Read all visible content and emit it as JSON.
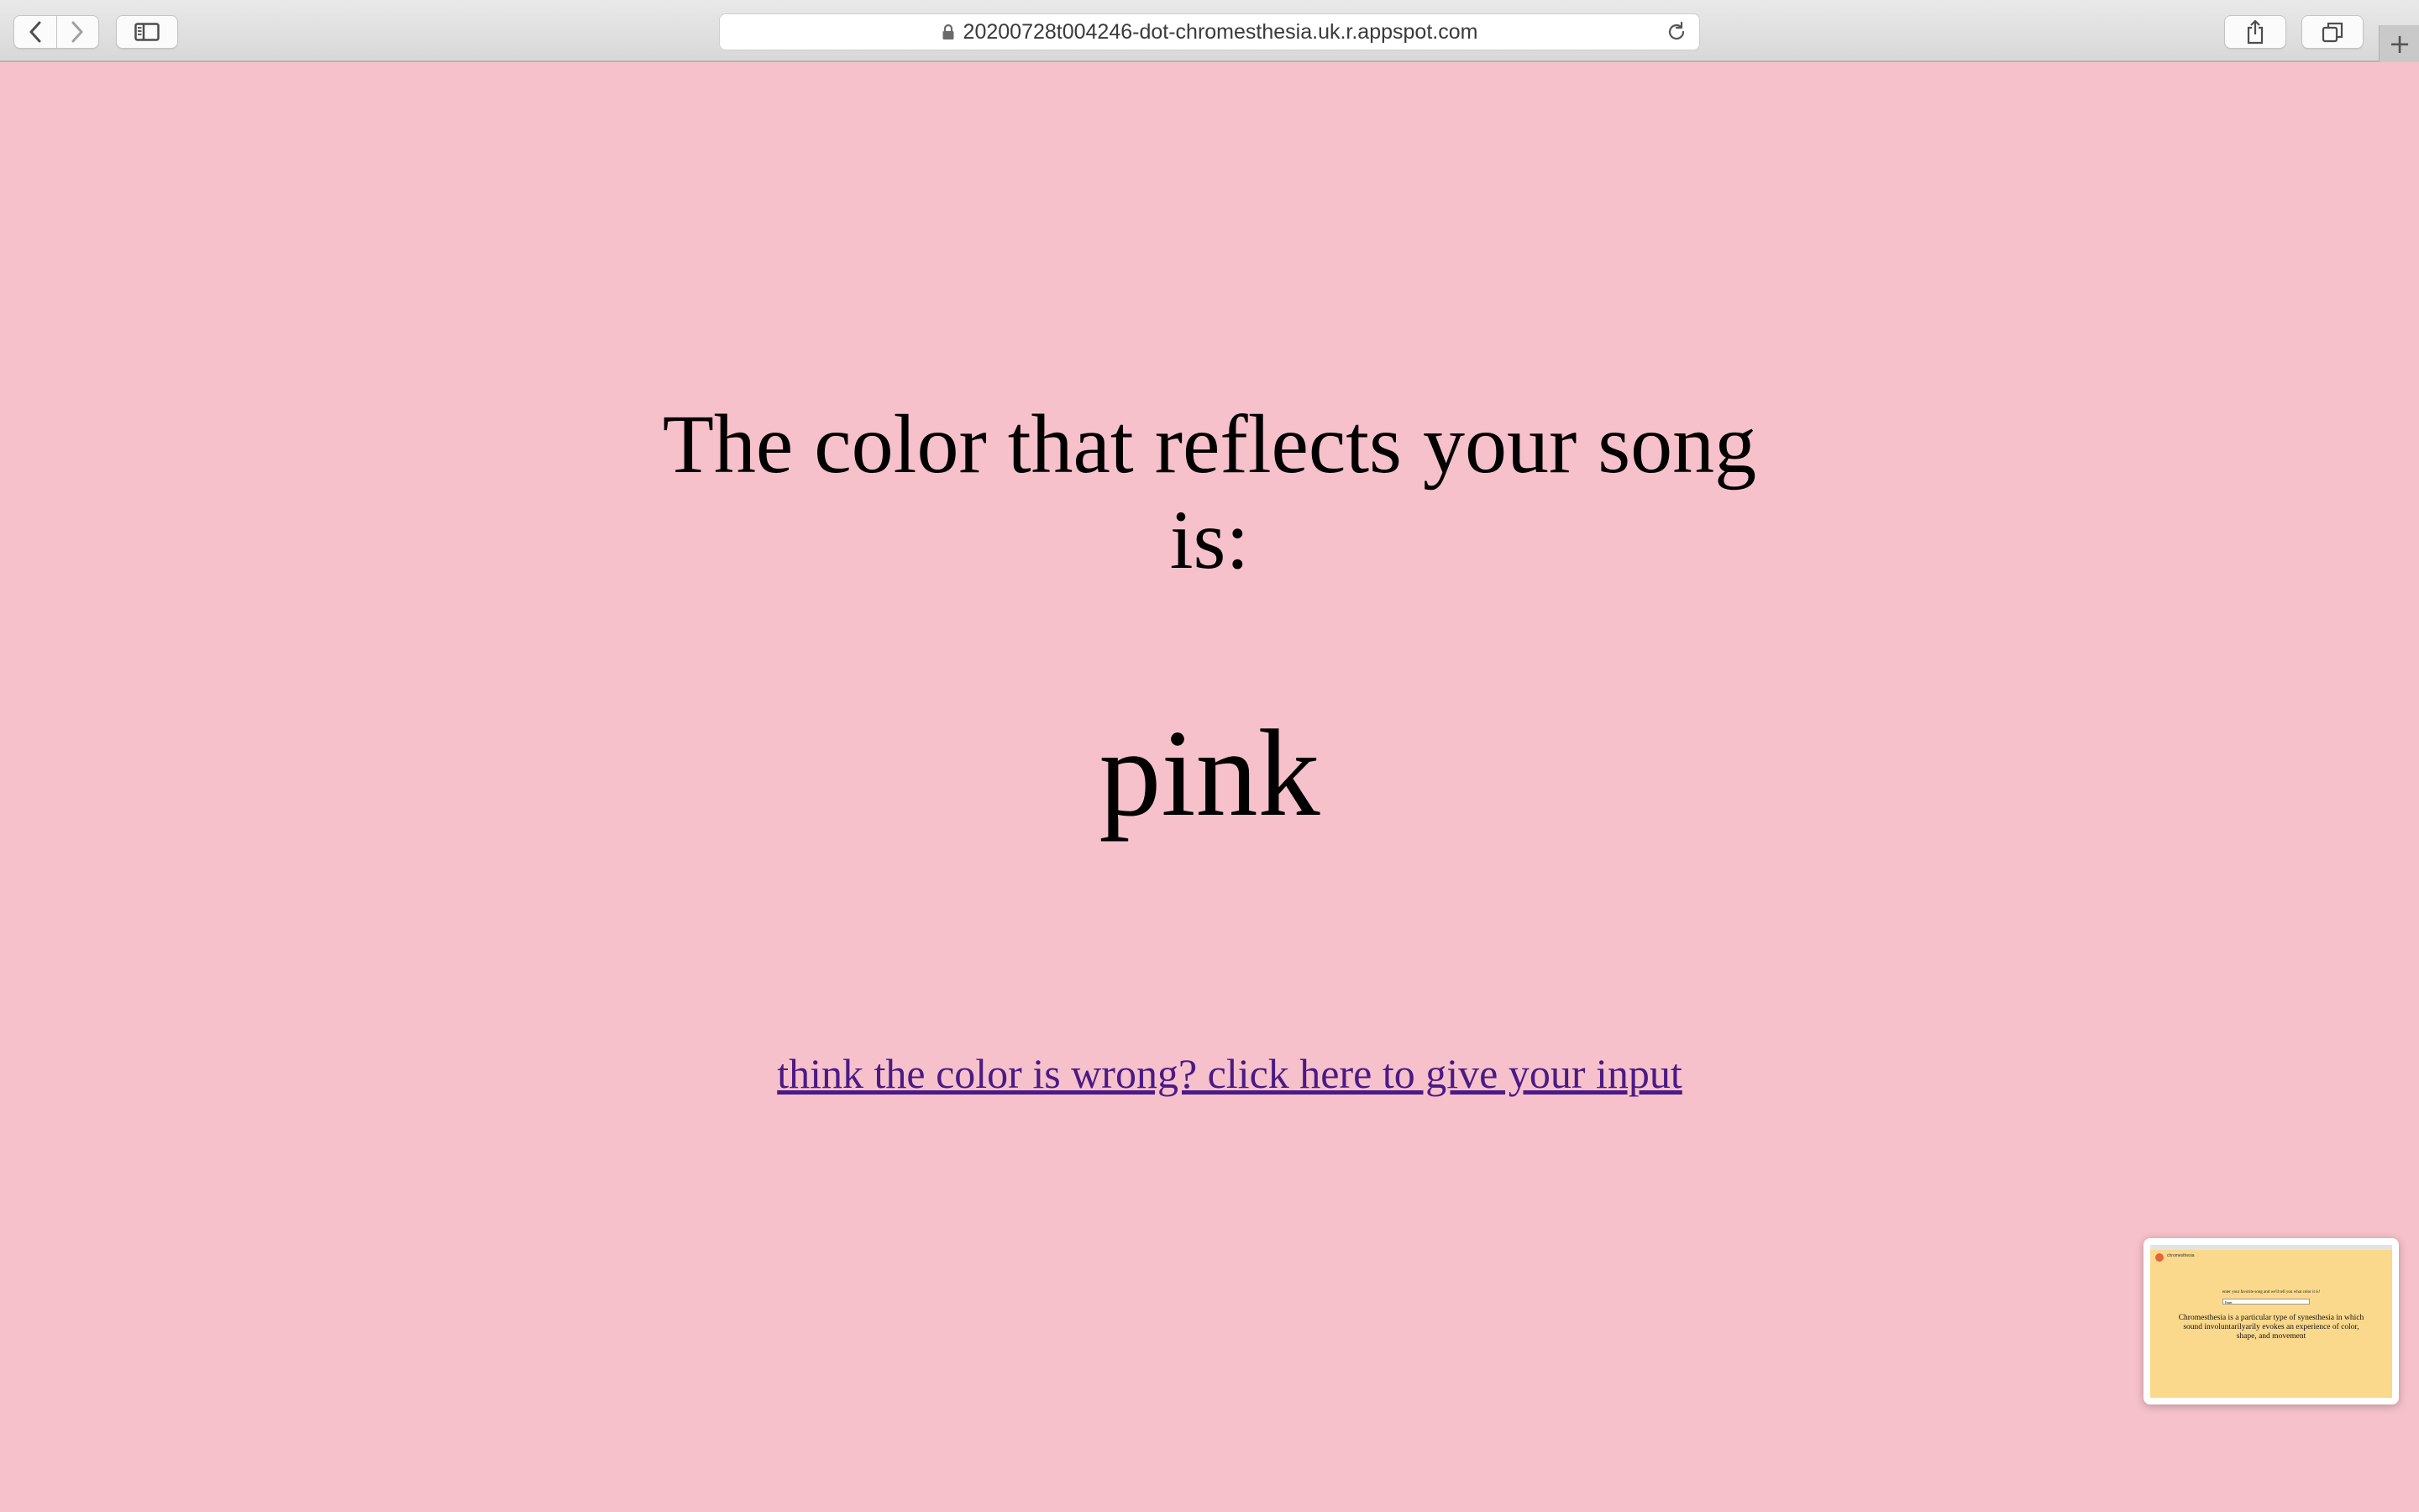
{
  "browser": {
    "url": "20200728t004246-dot-chromesthesia.uk.r.appspot.com",
    "icons": {
      "back": "chevron-left-icon",
      "forward": "chevron-right-icon",
      "sidebar": "sidebar-icon",
      "lock": "lock-icon",
      "reload": "reload-icon",
      "share": "share-icon",
      "tabs": "tabs-overview-icon",
      "new_tab": "plus-icon"
    }
  },
  "page": {
    "background_color": "#f6c1ca",
    "heading": "The color that reflects your song is:",
    "color_name": "pink",
    "feedback_link": "think the color is wrong? click here to give your input",
    "link_color": "#4a1a86"
  },
  "tab_preview": {
    "background_color": "#fbd98c",
    "logo_text": "chromesthesia",
    "prompt": "enter your favorite song and we'll tell you what color it is!",
    "input_value": "Enter",
    "description": "Chromesthesia is a particular type of synesthesia in which sound involuntarilyarily evokes an experience of color, shape, and movement"
  }
}
